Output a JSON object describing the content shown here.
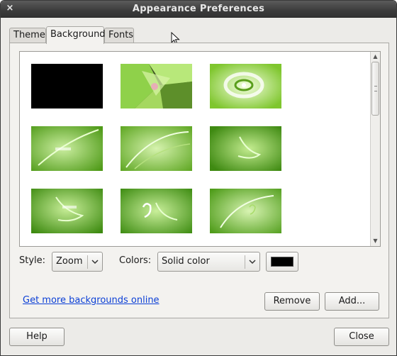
{
  "window": {
    "title": "Appearance Preferences",
    "close_glyph": "×"
  },
  "tabs": [
    {
      "label": "Theme",
      "active": false
    },
    {
      "label": "Background",
      "active": true
    },
    {
      "label": "Fonts",
      "active": false
    }
  ],
  "style_field": {
    "label": "Style:",
    "value": "Zoom"
  },
  "colors_field": {
    "label": "Colors:",
    "value": "Solid color",
    "swatch_color": "#000000"
  },
  "link": {
    "text": "Get more backgrounds online"
  },
  "buttons": {
    "remove": "Remove",
    "add": "Add...",
    "help": "Help",
    "close": "Close"
  },
  "colors": {
    "titlebar": "#3c3c3c",
    "link": "#0b3fd6",
    "wallpaper_green": "#6fb52c"
  },
  "icons": [
    "close-icon",
    "mouse-pointer-icon",
    "chevron-down-icon",
    "scroll-up-icon",
    "scroll-down-icon"
  ]
}
